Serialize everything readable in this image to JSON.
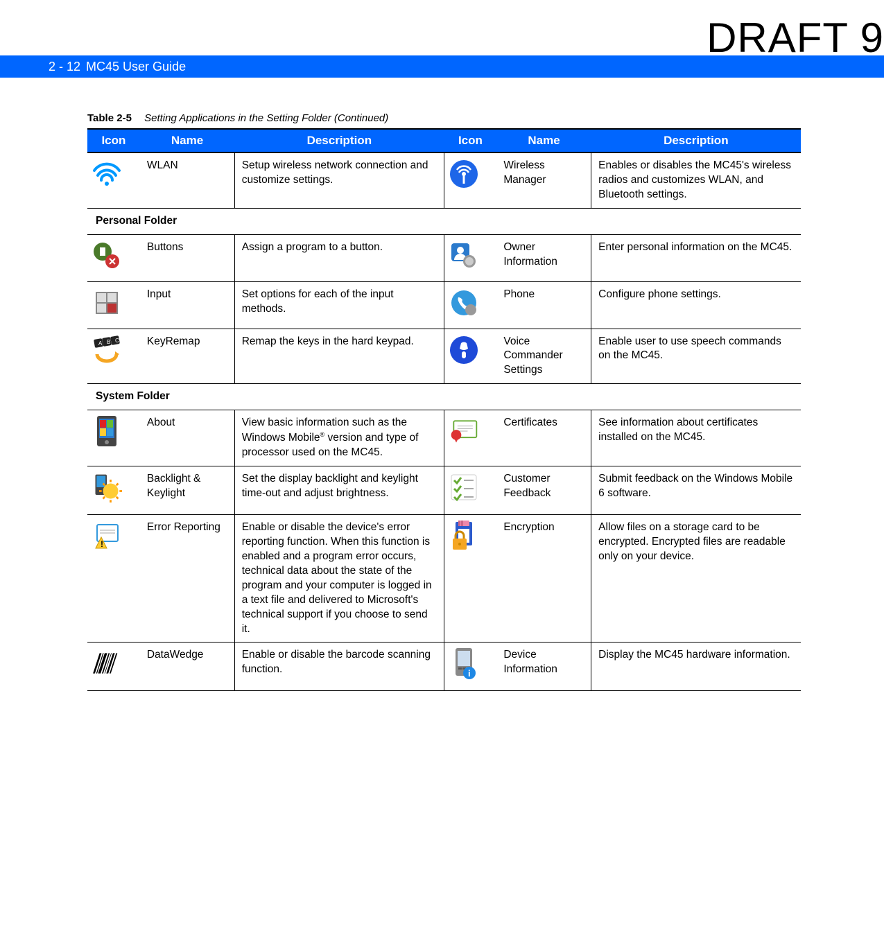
{
  "watermark": "DRAFT 9",
  "banner": {
    "page": "2 - 12",
    "title": "MC45 User Guide"
  },
  "table": {
    "number": "Table 2-5",
    "title": "Setting Applications in the Setting Folder (Continued)",
    "headers": [
      "Icon",
      "Name",
      "Description",
      "Icon",
      "Name",
      "Description"
    ],
    "sections": [
      {
        "rows": [
          {
            "left": {
              "icon": "wifi",
              "name": "WLAN",
              "desc": "Setup wireless network connection and customize settings."
            },
            "right": {
              "icon": "antenna",
              "name": "Wireless Manager",
              "desc": "Enables or disables the MC45's wireless radios and customizes WLAN, and Bluetooth settings."
            }
          }
        ]
      },
      {
        "heading": "Personal Folder",
        "rows": [
          {
            "left": {
              "icon": "buttons",
              "name": "Buttons",
              "desc": "Assign a program to a button."
            },
            "right": {
              "icon": "owner",
              "name": "Owner Information",
              "desc": "Enter personal information on the MC45."
            }
          },
          {
            "left": {
              "icon": "input",
              "name": "Input",
              "desc": "Set options for each of the input methods."
            },
            "right": {
              "icon": "phone",
              "name": "Phone",
              "desc": "Configure phone settings."
            }
          },
          {
            "left": {
              "icon": "keyremap",
              "name": "KeyRemap",
              "desc": "Remap the keys in the hard keypad."
            },
            "right": {
              "icon": "voice",
              "name": "Voice Commander Settings",
              "desc": "Enable user to use speech commands on the MC45."
            }
          }
        ]
      },
      {
        "heading": "System Folder",
        "rows": [
          {
            "left": {
              "icon": "about",
              "name": "About",
              "desc_html": "View basic information such as the Windows Mobile<sup>®</sup> version and type of processor used on the MC45."
            },
            "right": {
              "icon": "cert",
              "name": "Certificates",
              "desc": "See information about certificates installed on the MC45."
            }
          },
          {
            "left": {
              "icon": "backlight",
              "name": "Backlight & Keylight",
              "desc": "Set the display backlight and keylight time-out and adjust brightness."
            },
            "right": {
              "icon": "feedback",
              "name": "Customer Feedback",
              "desc": "Submit feedback on the Windows Mobile 6 software."
            }
          },
          {
            "left": {
              "icon": "error",
              "name": "Error Reporting",
              "desc": "Enable or disable the device's error reporting function. When this function is enabled and a program error occurs, technical data about the state of the program and your computer is logged in a text file and delivered to Microsoft's technical support if you choose to send it."
            },
            "right": {
              "icon": "encrypt",
              "name": "Encryption",
              "desc": "Allow files on a storage card to be encrypted. Encrypted files are readable only on your device."
            }
          },
          {
            "left": {
              "icon": "datawedge",
              "name": "DataWedge",
              "desc": "Enable or disable the barcode scanning function."
            },
            "right": {
              "icon": "devinfo",
              "name": "Device Information",
              "desc": "Display the MC45 hardware information."
            }
          }
        ]
      }
    ]
  }
}
